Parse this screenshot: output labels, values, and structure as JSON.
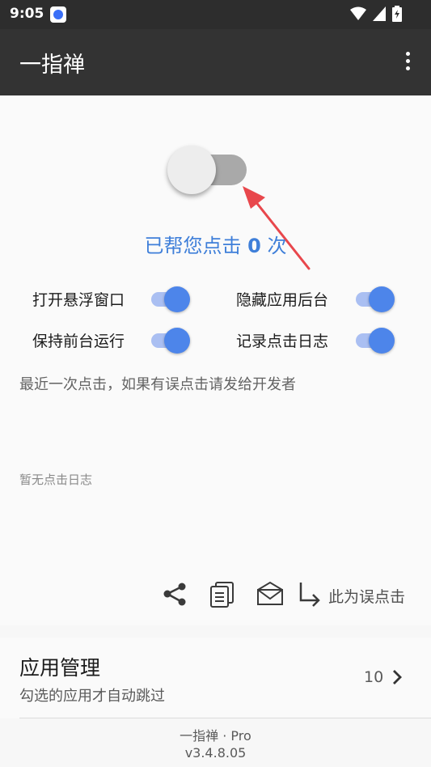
{
  "status_bar": {
    "time": "9:05"
  },
  "app_bar": {
    "title": "一指禅"
  },
  "main": {
    "click_count_prefix": "已帮您点击",
    "click_count": "0",
    "click_count_suffix": "次",
    "options": [
      {
        "label": "打开悬浮窗口",
        "enabled": true
      },
      {
        "label": "隐藏应用后台",
        "enabled": true
      },
      {
        "label": "保持前台运行",
        "enabled": true
      },
      {
        "label": "记录点击日志",
        "enabled": true
      }
    ],
    "recent_click_hint": "最近一次点击，如果有误点击请发给开发者",
    "no_log_text": "暂无点击日志",
    "mistake_label": "此为误点击"
  },
  "app_management": {
    "title": "应用管理",
    "subtitle": "勾选的应用才自动跳过",
    "count": "10"
  },
  "footer": {
    "line1": "一指禅 · Pro",
    "line2": "v3.4.8.05"
  },
  "colors": {
    "accent": "#3f7fd9",
    "toggle_on": "#4d85ea",
    "arrow": "#e8474c",
    "app_bar": "#333333"
  }
}
